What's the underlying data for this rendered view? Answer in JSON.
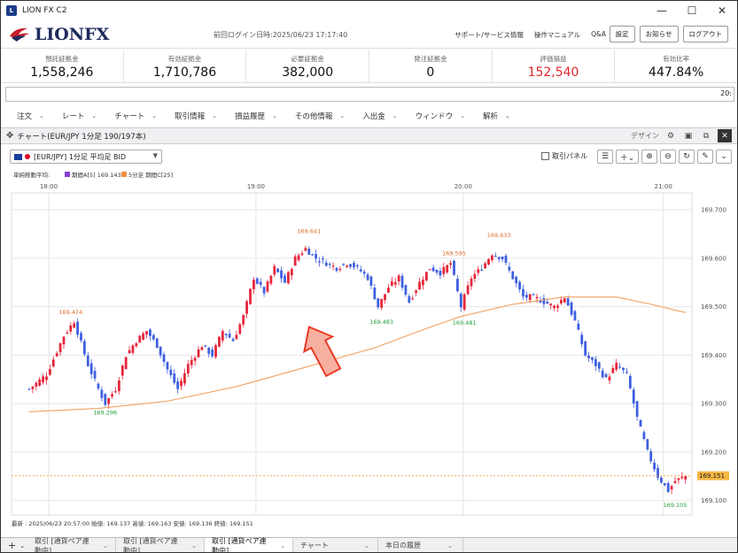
{
  "window": {
    "title": "LION FX C2",
    "minimize": "—",
    "maximize": "☐",
    "close": "✕"
  },
  "header": {
    "logo_text": "LIONFX",
    "last_login": "前回ログイン日時:2025/06/23 17:17:40",
    "links": [
      "サポート/サービス情報",
      "操作マニュアル",
      "Q&A"
    ],
    "buttons": [
      "設定",
      "お知らせ",
      "ログアウト"
    ]
  },
  "summary": [
    {
      "label": "預託証拠金",
      "value": "1,558,246",
      "highlight": false
    },
    {
      "label": "有効証拠金",
      "value": "1,710,786",
      "highlight": false
    },
    {
      "label": "必要証拠金",
      "value": "382,000",
      "highlight": false
    },
    {
      "label": "発注証拠金",
      "value": "0",
      "highlight": false
    },
    {
      "label": "評価損益",
      "value": "152,540",
      "highlight": true
    },
    {
      "label": "有効比率",
      "value": "447.84%",
      "highlight": false
    }
  ],
  "ticker": {
    "text": "20:"
  },
  "menu": [
    "注文",
    "レート",
    "チャート",
    "取引情報",
    "損益履歴",
    "その他情報",
    "入出金",
    "ウィンドウ",
    "解析"
  ],
  "chart_window": {
    "title": "チャート(EUR/JPY 1分足 190/197本)",
    "design_label": "デザイン",
    "symbol_select": "[EUR/JPY] 1分足 平均足 BID",
    "panel_label": "取引パネル"
  },
  "bottom_tabs": [
    {
      "label": "取引 [通貨ペア連動中]",
      "active": false
    },
    {
      "label": "取引 [通貨ペア連動中]",
      "active": false
    },
    {
      "label": "取引 [通貨ペア連動中]",
      "active": true
    },
    {
      "label": "チャート",
      "active": false
    },
    {
      "label": "本日の履歴",
      "active": false
    }
  ],
  "colors": {
    "up": "#e8253a",
    "down": "#3d5fe0",
    "ma": "#f0a060",
    "accent_red": "#e0262c",
    "price_tag": "#f5b642"
  },
  "chart_data": {
    "type": "candlestick",
    "legend_title": "単純移動平均:",
    "legend": [
      {
        "name": "期間A[5] 169.143",
        "color": "#8b3fd1"
      },
      {
        "name": "5分足 期間C[25]",
        "color": "#f09040"
      }
    ],
    "x_ticks": [
      "18:00",
      "19:00",
      "20:00",
      "21:00"
    ],
    "y_ticks": [
      "169.700",
      "169.600",
      "169.500",
      "169.400",
      "169.300",
      "169.200",
      "169.100"
    ],
    "ylim": [
      169.07,
      169.735
    ],
    "current_price": "169.151",
    "annotations": [
      {
        "text": "169.474",
        "kind": "high",
        "x_minute": 12,
        "y": 169.474
      },
      {
        "text": "169.296",
        "kind": "low",
        "x_minute": 22,
        "y": 169.296
      },
      {
        "text": "169.641",
        "kind": "high",
        "x_minute": 81,
        "y": 169.641
      },
      {
        "text": "169.483",
        "kind": "low",
        "x_minute": 102,
        "y": 169.483
      },
      {
        "text": "169.595",
        "kind": "high",
        "x_minute": 123,
        "y": 169.595
      },
      {
        "text": "169.481",
        "kind": "low",
        "x_minute": 126,
        "y": 169.481
      },
      {
        "text": "169.633",
        "kind": "high",
        "x_minute": 136,
        "y": 169.633
      },
      {
        "text": "169.105",
        "kind": "low",
        "x_minute": 187,
        "y": 169.105
      }
    ],
    "footer": "最新 : 2025/06/23 20:57:00 始値: 169.137 高値: 169.163 安値: 169.136 終値: 169.151",
    "ma_points": [
      [
        0,
        169.283
      ],
      [
        20,
        169.29
      ],
      [
        40,
        169.305
      ],
      [
        60,
        169.335
      ],
      [
        80,
        169.375
      ],
      [
        100,
        169.415
      ],
      [
        115,
        169.455
      ],
      [
        125,
        169.48
      ],
      [
        140,
        169.505
      ],
      [
        155,
        169.52
      ],
      [
        170,
        169.52
      ],
      [
        180,
        169.505
      ],
      [
        190,
        169.488
      ]
    ],
    "close_points": [
      [
        0,
        169.33
      ],
      [
        5,
        169.36
      ],
      [
        10,
        169.44
      ],
      [
        13,
        169.47
      ],
      [
        17,
        169.38
      ],
      [
        20,
        169.33
      ],
      [
        22,
        169.3
      ],
      [
        25,
        169.33
      ],
      [
        28,
        169.4
      ],
      [
        31,
        169.43
      ],
      [
        34,
        169.45
      ],
      [
        37,
        169.42
      ],
      [
        40,
        169.37
      ],
      [
        43,
        169.33
      ],
      [
        46,
        169.38
      ],
      [
        50,
        169.42
      ],
      [
        53,
        169.4
      ],
      [
        56,
        169.45
      ],
      [
        59,
        169.43
      ],
      [
        62,
        169.48
      ],
      [
        65,
        169.56
      ],
      [
        68,
        169.53
      ],
      [
        71,
        169.58
      ],
      [
        74,
        169.55
      ],
      [
        77,
        169.6
      ],
      [
        80,
        169.62
      ],
      [
        83,
        169.6
      ],
      [
        86,
        169.59
      ],
      [
        89,
        169.58
      ],
      [
        92,
        169.59
      ],
      [
        95,
        169.58
      ],
      [
        98,
        169.56
      ],
      [
        101,
        169.5
      ],
      [
        104,
        169.54
      ],
      [
        107,
        169.56
      ],
      [
        110,
        169.51
      ],
      [
        113,
        169.55
      ],
      [
        116,
        169.58
      ],
      [
        119,
        169.57
      ],
      [
        122,
        169.59
      ],
      [
        125,
        169.5
      ],
      [
        128,
        169.56
      ],
      [
        131,
        169.58
      ],
      [
        134,
        169.61
      ],
      [
        137,
        169.6
      ],
      [
        140,
        169.56
      ],
      [
        143,
        169.52
      ],
      [
        146,
        169.52
      ],
      [
        149,
        169.51
      ],
      [
        152,
        169.5
      ],
      [
        155,
        169.52
      ],
      [
        158,
        169.47
      ],
      [
        161,
        169.4
      ],
      [
        164,
        169.38
      ],
      [
        167,
        169.35
      ],
      [
        170,
        169.38
      ],
      [
        173,
        169.36
      ],
      [
        176,
        169.27
      ],
      [
        179,
        169.2
      ],
      [
        182,
        169.15
      ],
      [
        185,
        169.12
      ],
      [
        187,
        169.14
      ],
      [
        190,
        169.15
      ]
    ]
  }
}
